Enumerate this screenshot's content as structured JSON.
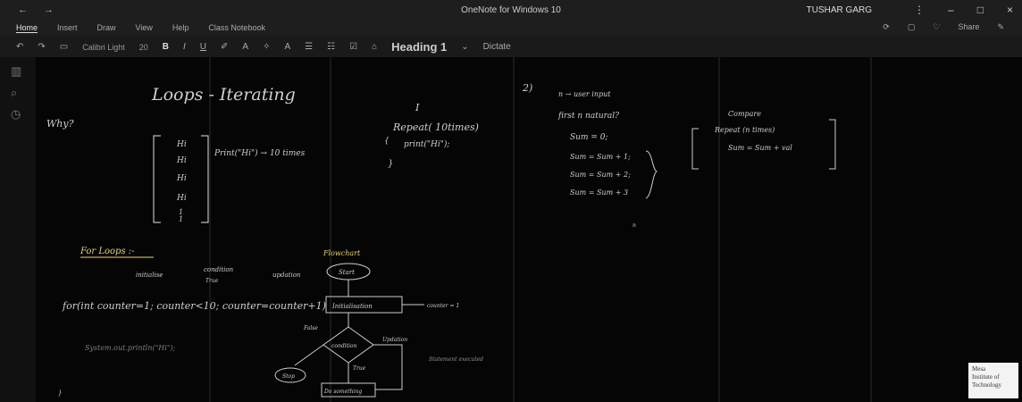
{
  "window": {
    "title": "OneNote for Windows 10",
    "user": "TUSHAR GARG",
    "nav_back": "←",
    "nav_forward": "→",
    "btn_more": "⋮",
    "btn_min": "–",
    "btn_max": "□",
    "btn_close": "×"
  },
  "menu": {
    "tabs": [
      "Home",
      "Insert",
      "Draw",
      "View",
      "Help",
      "Class Notebook"
    ],
    "active_tab": "Home",
    "share": "Share"
  },
  "ribbon": {
    "font_name": "Calibri Light",
    "font_size": "20",
    "bold": "B",
    "italic": "I",
    "underline": "U",
    "style": "Heading 1",
    "dictate": "Dictate"
  },
  "notes": {
    "title": "Loops - Iterating",
    "why": "Why?",
    "print_hi": "Print(\"Hi\") → 10 times",
    "hi_lines": [
      "Hi",
      "Hi",
      "Hi",
      "Hi",
      "1",
      "1"
    ],
    "i_mark": "I",
    "repeat": "Repeat( 10times)",
    "print_stmt": "print(\"Hi\");",
    "section2": "2)",
    "n_input": "n → user input",
    "first_natural": "first n natural?",
    "sum0": "Sum = 0;",
    "sum1": "Sum = Sum + 1;",
    "sum2": "Sum = Sum + 2;",
    "sum3": "Sum = Sum + 3",
    "n_dots": "n",
    "repeat_n": "Repeat (n times)",
    "sum_loop": "Sum = Sum + val",
    "compare": "Compare",
    "for_loops": "For Loops :-",
    "init": "initialise",
    "cond": "condition",
    "true_label": "True",
    "updation": "updation",
    "for_stmt": "for(int counter=1; counter<10; counter=counter+1)",
    "system_print": "System.out.println(\"Hi\");",
    "flowchart": "Flowchart",
    "start": "Start",
    "initialise_box": "Initialisation",
    "condition": "condition",
    "false_label": "False",
    "true2": "True",
    "stop": "Stop",
    "do_something": "Do something",
    "updation2": "Updation",
    "counter": "counter = 1",
    "inside": "Statement executed"
  },
  "logo": {
    "line1": "Mesa",
    "line2": "Institute of",
    "line3": "Technology"
  }
}
